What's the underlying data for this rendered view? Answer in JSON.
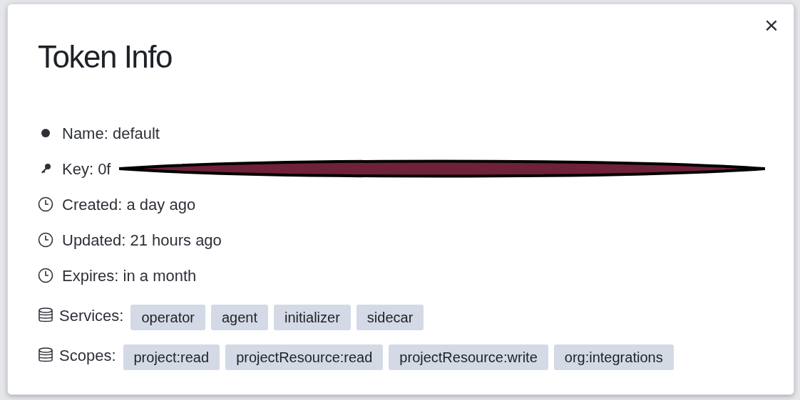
{
  "dialog": {
    "title": "Token Info",
    "close_label": "×",
    "fields": [
      {
        "kind": "dot",
        "text": "Name: default"
      },
      {
        "kind": "key",
        "text": "Key: 0f",
        "redacted": true
      },
      {
        "kind": "clock",
        "text": "Created: a day ago"
      },
      {
        "kind": "clock",
        "text": "Updated: 21 hours ago"
      },
      {
        "kind": "clock",
        "text": "Expires: in a month"
      }
    ],
    "tag_groups": [
      {
        "label": "Services:",
        "tags": [
          "operator",
          "agent",
          "initializer",
          "sidecar"
        ]
      },
      {
        "label": "Scopes:",
        "tags": [
          "project:read",
          "projectResource:read",
          "projectResource:write",
          "org:integrations"
        ]
      }
    ]
  }
}
